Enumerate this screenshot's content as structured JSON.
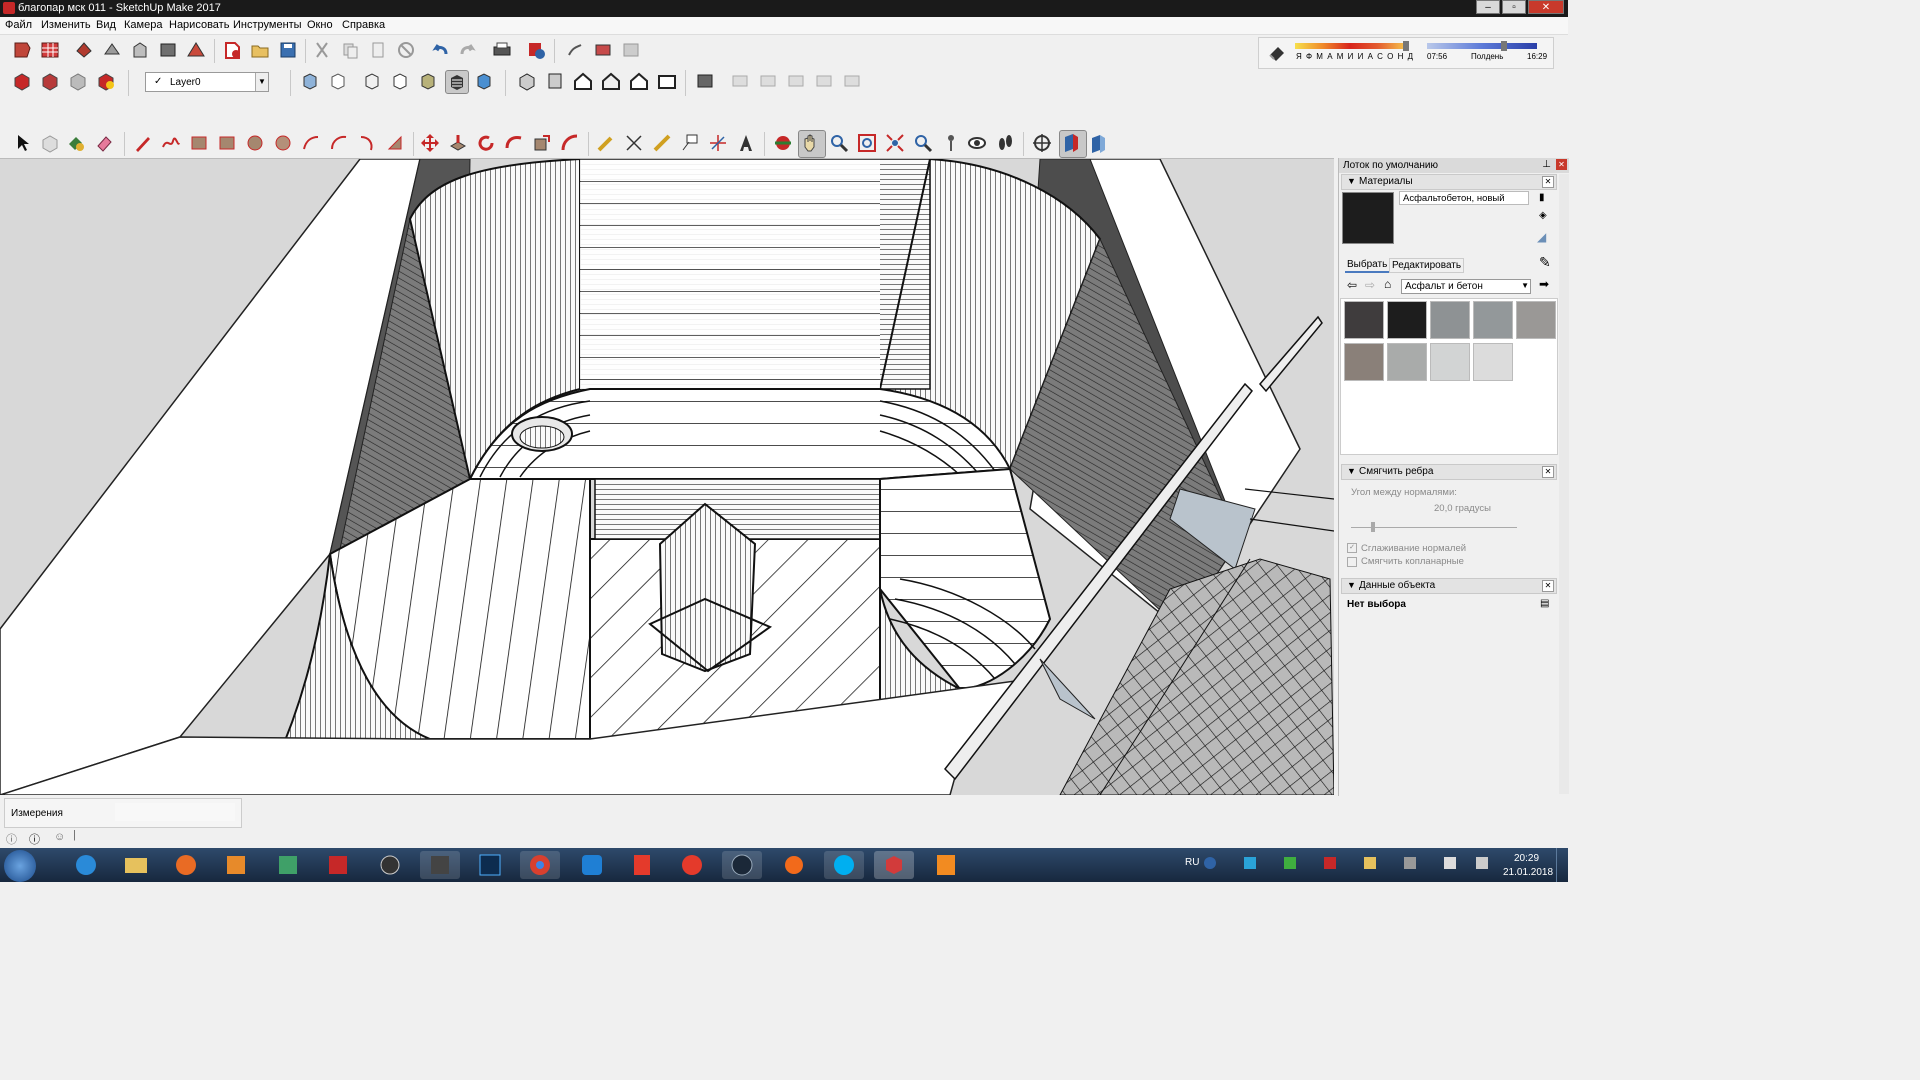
{
  "window": {
    "title": "благопар мск 011 - SketchUp Make 2017"
  },
  "menu": {
    "items": [
      "Файл",
      "Изменить",
      "Вид",
      "Камера",
      "Нарисовать",
      "Инструменты",
      "Окно",
      "Справка"
    ]
  },
  "layer": {
    "check": "✓",
    "name": "Layer0"
  },
  "shadow": {
    "months": "Я Ф М А М И И А С О Н Д",
    "time_start": "07:56",
    "time_mid": "Полдень",
    "time_end": "16:29"
  },
  "tray": {
    "title": "Лоток по умолчанию",
    "materials": {
      "title": "Материалы",
      "current_name": "Асфальтобетон, новый",
      "tab_select": "Выбрать",
      "tab_edit": "Редактировать",
      "library": "Асфальт и бетон",
      "swatch_colors": [
        "#3f3c3d",
        "#1d1d1d",
        "#8e9294",
        "#93989a",
        "#9a9896",
        "#8a8079",
        "#a9abaa",
        "#d2d4d4",
        "#dcdcdc"
      ]
    },
    "soften": {
      "title": "Смягчить ребра",
      "angle_label": "Угол между нормалями:",
      "angle_value": "20,0  градусы",
      "smooth_normals": "Сглаживание нормалей",
      "soften_coplanar": "Смягчить копланарные"
    },
    "entity": {
      "title": "Данные объекта",
      "no_selection": "Нет выбора"
    }
  },
  "status": {
    "measurements_label": "Измерения"
  },
  "taskbar": {
    "language": "RU",
    "time": "20:29",
    "date": "21.01.2018"
  },
  "colors": {
    "titlebar": "#1a1a1a",
    "close": "#c8392b",
    "taskbar": "#1f3550"
  }
}
